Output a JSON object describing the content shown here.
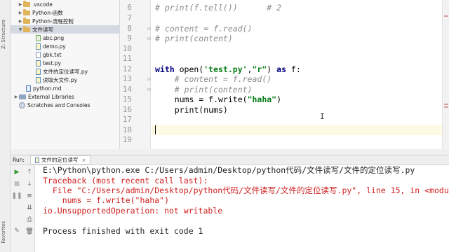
{
  "left_strip": {
    "structure_label": "Z: Structure",
    "favorites_label": "Favorites"
  },
  "project_tree": {
    "items": [
      {
        "name": ".vscode",
        "kind": "folder",
        "expanded": false
      },
      {
        "name": "Python-函数",
        "kind": "folder",
        "expanded": false
      },
      {
        "name": "Python-流程控制",
        "kind": "folder",
        "expanded": false
      },
      {
        "name": "文件读写",
        "kind": "folder",
        "expanded": true,
        "selected": true
      },
      {
        "name": "abc.png",
        "kind": "png"
      },
      {
        "name": "demo.py",
        "kind": "py"
      },
      {
        "name": "gbk.txt",
        "kind": "txt"
      },
      {
        "name": "test.py",
        "kind": "py"
      },
      {
        "name": "文件的定位读写.py",
        "kind": "py"
      },
      {
        "name": "读取大文件.py",
        "kind": "py"
      },
      {
        "name": "python.md",
        "kind": "md"
      },
      {
        "name": "External Libraries",
        "kind": "libs",
        "expanded": false
      },
      {
        "name": "Scratches and Consoles",
        "kind": "scratch"
      }
    ]
  },
  "editor": {
    "line_numbers": [
      "6",
      "7",
      "8",
      "9",
      "10",
      "11",
      "12",
      "13",
      "14",
      "15",
      "16",
      "17",
      "18",
      "19"
    ],
    "lines": [
      {
        "text": "# print(f.tell())      # 2"
      },
      {
        "text": ""
      },
      {
        "text": "# content = f.read()"
      },
      {
        "text": "# print(content)"
      },
      {
        "text": ""
      },
      {
        "text": ""
      },
      {
        "kw1": "with",
        "mid1": " open(",
        "s1": "'test.py'",
        "mid2": ",",
        "s2": "\"r\"",
        "mid3": ") ",
        "kw2": "as",
        "end": " f:"
      },
      {
        "text": "    # content = f.read()"
      },
      {
        "text": "    # print(content)"
      },
      {
        "pre": "    nums = f.write(",
        "s": "\"haha\"",
        "post": ")"
      },
      {
        "text": "    print(nums)"
      },
      {
        "text": ""
      },
      {
        "text": ""
      },
      {
        "text": ""
      }
    ]
  },
  "run_panel": {
    "label": "Run:",
    "tab_label": "文件的定位读写",
    "close_symbol": "×",
    "console": {
      "command": "E:\\Python\\python.exe C:/Users/admin/Desktop/python代码/文件读写/文件的定位读写.py",
      "traceback": "Traceback (most recent call last):",
      "file_prefix": "  File \"",
      "file_link": "C:/Users/admin/Desktop/python代码/文件读写/文件的定位读写.py",
      "file_suffix": "\", line 15, in <module>",
      "code_line": "    nums = f.write(\"haha\")",
      "error": "io.UnsupportedOperation: not writable",
      "exit": "Process finished with exit code 1"
    }
  },
  "colors": {
    "keyword": "#000080",
    "string": "#067d17",
    "comment": "#8c8c8c",
    "error": "#d02020",
    "link": "#2a45c9",
    "current_line": "#fffae3"
  },
  "icons": [
    "folder-icon",
    "file-icon",
    "python-file-icon",
    "rerun-icon",
    "stop-icon",
    "scroll-up-icon",
    "scroll-down-icon",
    "wrap-icon",
    "print-icon",
    "trash-icon",
    "pin-icon"
  ]
}
